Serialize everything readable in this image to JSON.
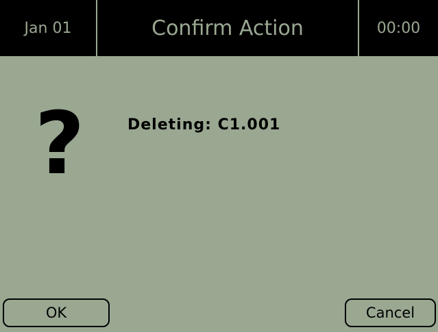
{
  "header": {
    "date": "Jan 01",
    "title": "Confirm Action",
    "time": "00:00"
  },
  "dialog": {
    "icon": "question-mark-icon",
    "icon_glyph": "?",
    "message": "Deleting: C1.001"
  },
  "buttons": {
    "ok_label": "OK",
    "cancel_label": "Cancel"
  },
  "colors": {
    "background": "#9aa892",
    "titlebar": "#000000",
    "text": "#000000"
  }
}
